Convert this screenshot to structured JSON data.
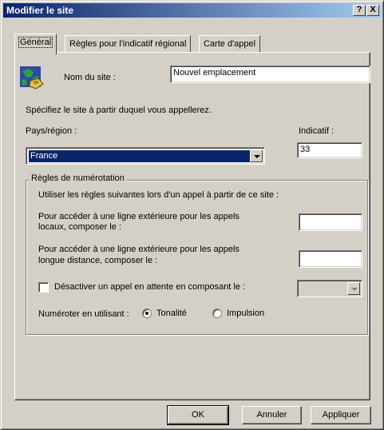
{
  "window": {
    "title": "Modifier le site",
    "help_btn": "?",
    "close_btn": "X"
  },
  "tabs": [
    {
      "label": "Général"
    },
    {
      "label": "Règles pour l'indicatif régional"
    },
    {
      "label": "Carte d'appel"
    }
  ],
  "general": {
    "site_name_label": "Nom du site :",
    "site_name_value": "Nouvel emplacement",
    "specify_text": "Spécifiez le site à partir duquel vous appellerez.",
    "country_label": "Pays/région :",
    "country_value": "France",
    "area_code_label": "Indicatif :",
    "area_code_value": "33"
  },
  "dialing_rules": {
    "legend": "Règles de numérotation",
    "intro": "Utiliser les règles suivantes lors d'un appel à partir de ce site :",
    "local_line1": "Pour accéder à une ligne extérieure pour les appels",
    "local_line2": "locaux, composer le :",
    "local_value": "",
    "long_line1": "Pour accéder à une ligne extérieure pour les appels",
    "long_line2": "longue distance, composer le :",
    "long_value": "",
    "call_waiting_label": "Désactiver un appel en attente en composant le :",
    "call_waiting_checked": false,
    "dial_using_label": "Numéroter en utilisant :",
    "tone_label": "Tonalité",
    "pulse_label": "Impulsion",
    "selected_mode": "Tonalité"
  },
  "buttons": {
    "ok": "OK",
    "cancel": "Annuler",
    "apply": "Appliquer"
  },
  "colors": {
    "face": "#d4d0c8",
    "title_start": "#0a246a",
    "title_end": "#a6caf0",
    "selection": "#0a246a"
  }
}
